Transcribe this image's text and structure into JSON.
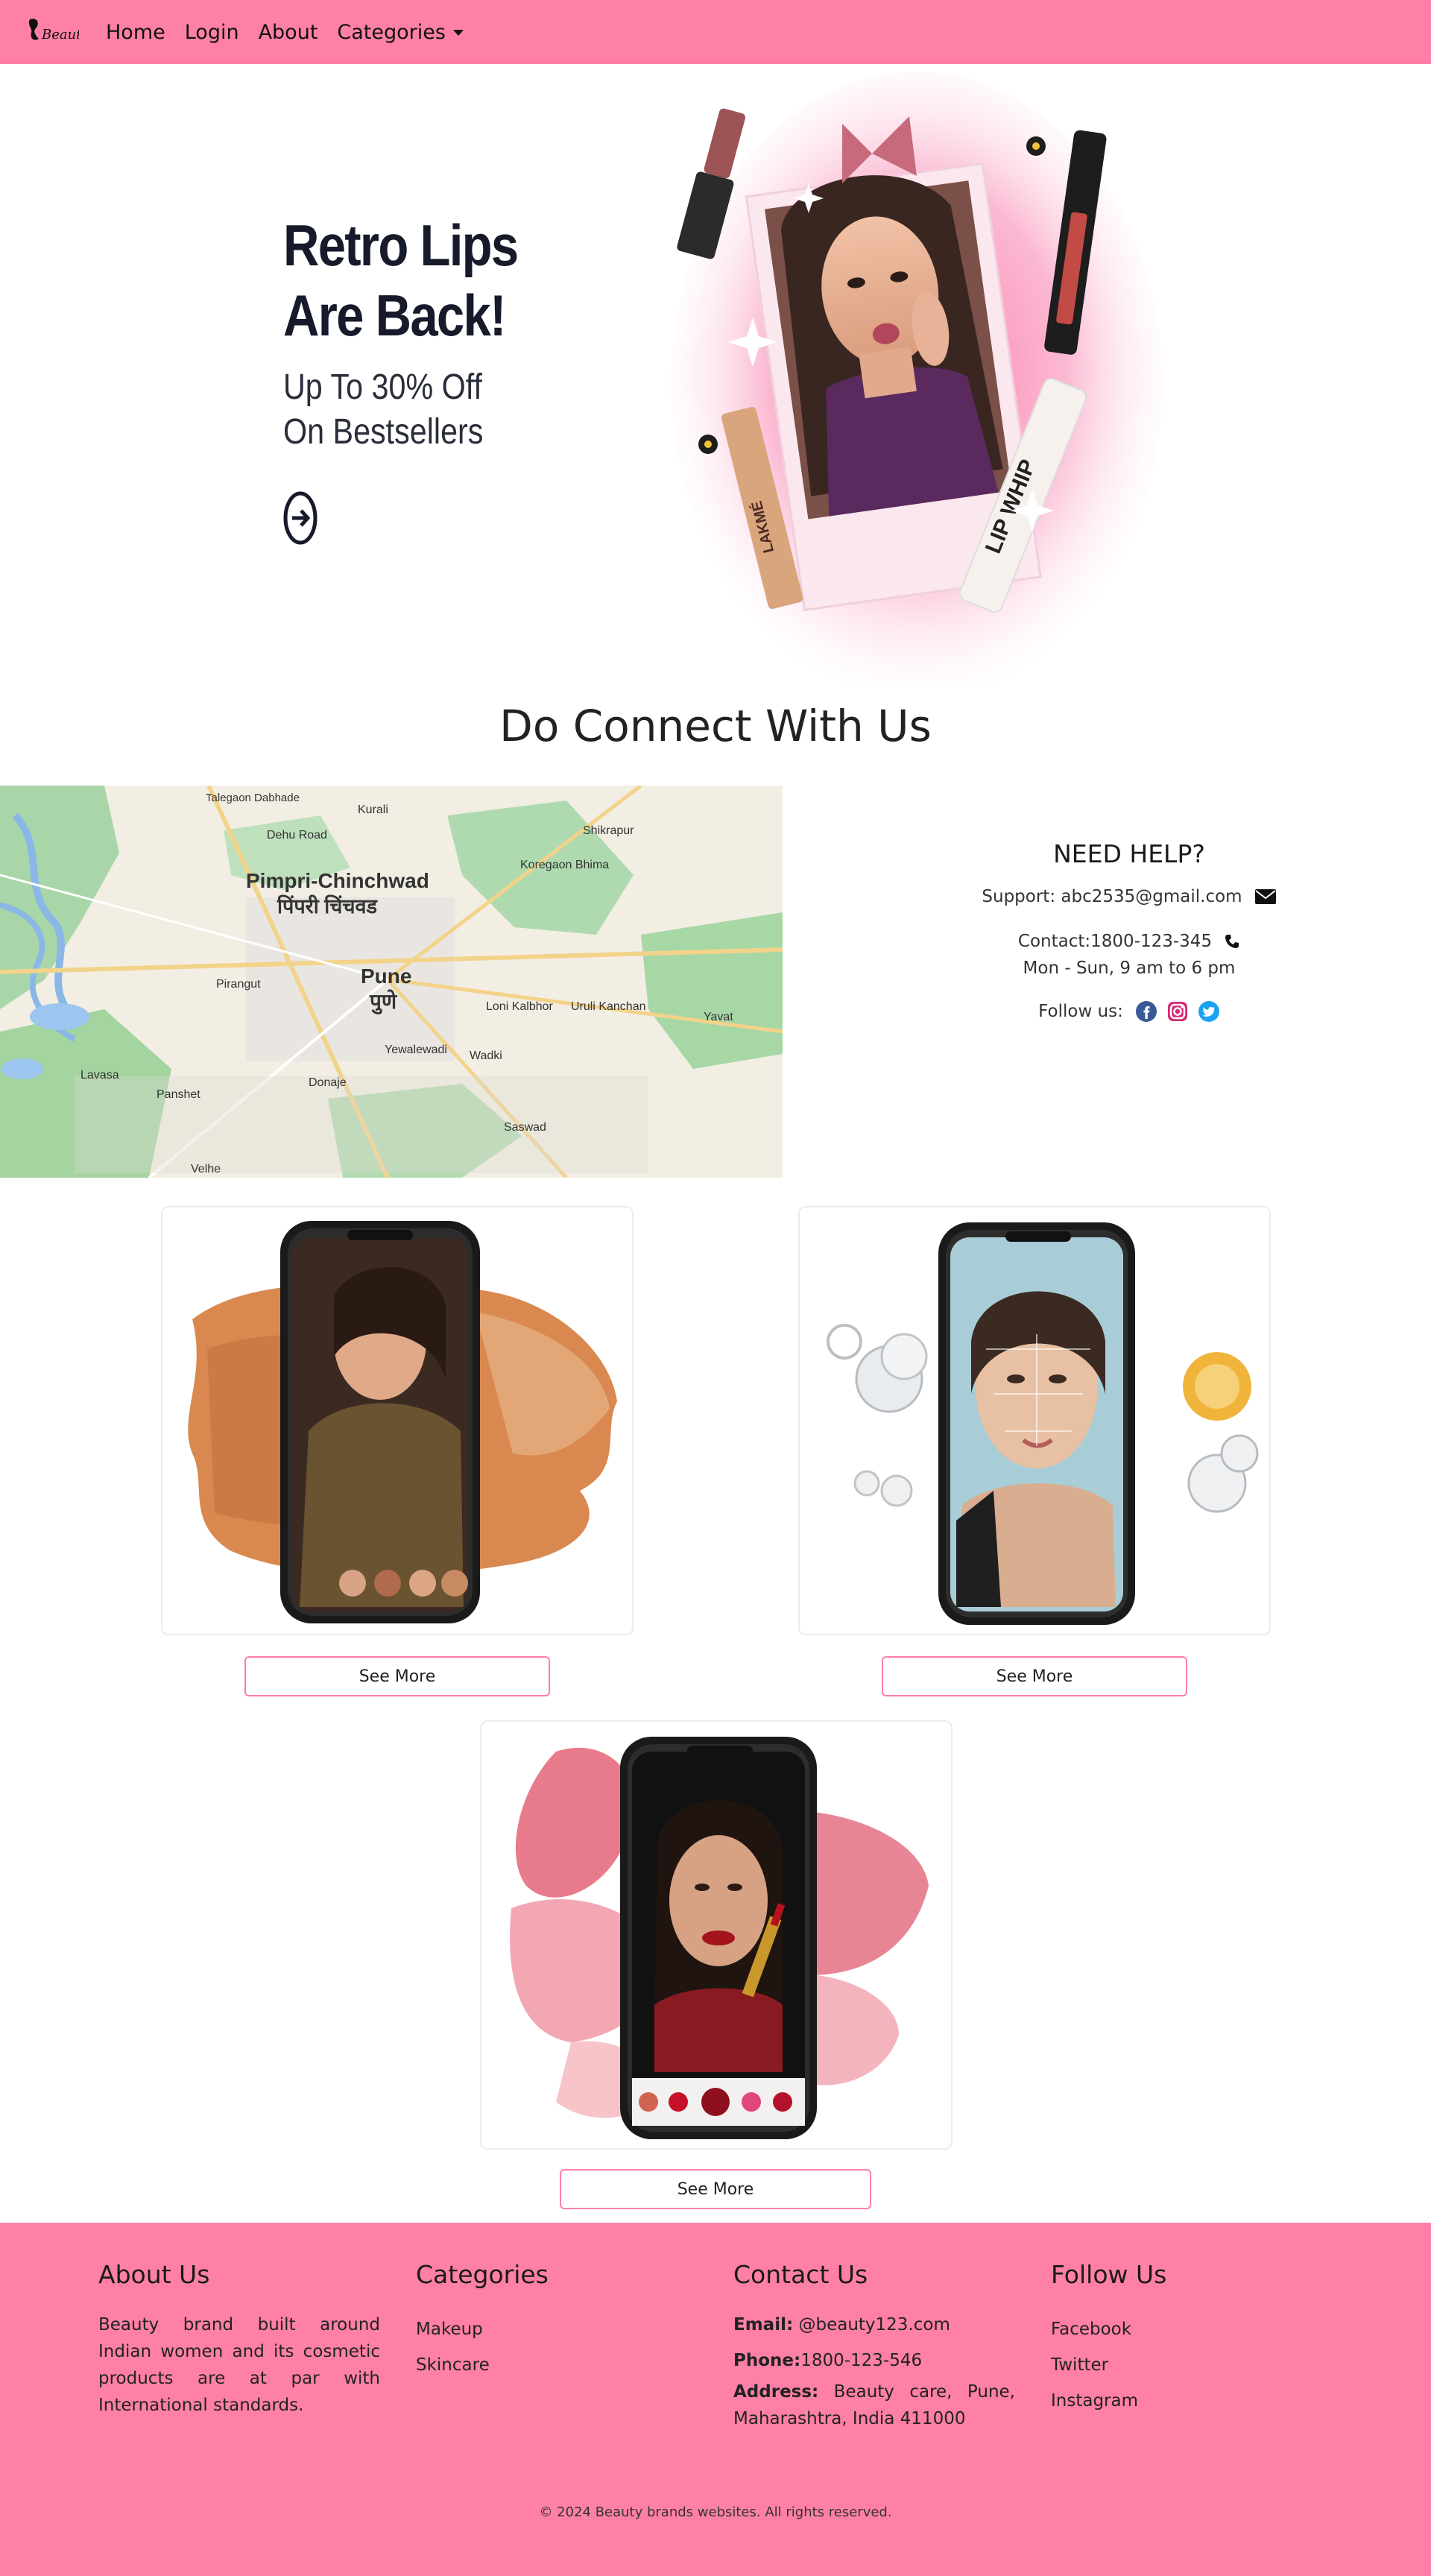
{
  "nav": {
    "logo_alt": "Beauty",
    "items": [
      {
        "label": "Home"
      },
      {
        "label": "Login"
      },
      {
        "label": "About"
      },
      {
        "label": "Categories"
      }
    ]
  },
  "hero": {
    "title": "Retro Lips\nAre Back!",
    "subtitle": "Up To 30% Off\nOn Bestsellers",
    "product_text_1": "LIP WHIP",
    "product_text_2": "LAKMÉ"
  },
  "connect": {
    "title": "Do Connect With Us"
  },
  "map": {
    "labels": [
      "Pimpri-Chinchwad",
      "पिंपरी चिंचवड",
      "Pune",
      "पुणे",
      "Dehu Road",
      "Kurali",
      "Shikrapur",
      "Koregaon Bhima",
      "Pirangut",
      "Loni Kalbhor",
      "Uruli Kanchan",
      "Yewalewadi",
      "Wadki",
      "Donaje",
      "Panshet",
      "Lavasa",
      "Saswad",
      "Yavat",
      "Velhe",
      "Talegaon Dabhade"
    ]
  },
  "help": {
    "title": "NEED HELP?",
    "support": "Support: abc2535@gmail.com",
    "contact": "Contact:1800-123-345",
    "hours": "Mon - Sun, 9 am to 6 pm",
    "follow": "Follow us:"
  },
  "cards": [
    {
      "button": "See More"
    },
    {
      "button": "See More"
    },
    {
      "button": "See More"
    }
  ],
  "footer": {
    "about_title": "About Us",
    "about_text": "Beauty brand built around Indian women and its cosmetic products are at par with International standards.",
    "categories_title": "Categories",
    "categories": [
      "Makeup",
      "Skincare"
    ],
    "contact_title": "Contact Us",
    "email_label": "Email:",
    "email_value": " @beauty123.com",
    "phone_label": "Phone:",
    "phone_value": "1800-123-546",
    "address_label": "Address:",
    "address_value": " Beauty care, Pune, Maharashtra, India 411000",
    "follow_title": "Follow Us",
    "follow_links": [
      "Facebook",
      "Twitter",
      "Instagram"
    ],
    "copyright": "© 2024 Beauty brands websites. All rights reserved."
  },
  "colors": {
    "brand_pink": "#ff80a6",
    "card_border": "#ececec"
  }
}
